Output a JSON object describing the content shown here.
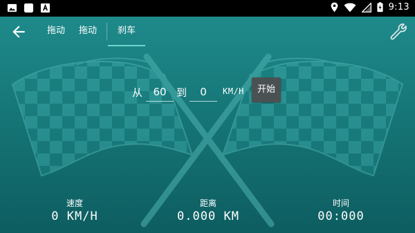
{
  "status_bar": {
    "time": "9:13",
    "left_icons": [
      "image-icon",
      "square-icon",
      "app-a-icon"
    ],
    "right_icons": [
      "location-icon",
      "wifi-icon",
      "signal-icon",
      "battery-charging-icon"
    ]
  },
  "toolbar": {
    "tabs": [
      {
        "label": "拖动"
      },
      {
        "label": "拖动"
      },
      {
        "label": "刹车"
      }
    ],
    "active_tab_index": 2
  },
  "form": {
    "from_label": "从",
    "from_value": "60",
    "to_label": "到",
    "to_value": "0",
    "unit": "KM/H",
    "start_label": "开始"
  },
  "stats": {
    "speed_caption": "速度",
    "speed_value": "0 KM/H",
    "distance_caption": "距离",
    "distance_value": "0.000 KM",
    "time_caption": "时间",
    "time_value": "00:000"
  },
  "colors": {
    "background_top": "#1f8a8b",
    "background_bottom": "#0d5d60",
    "accent": "#6fd6cf",
    "button": "#4a5152"
  }
}
